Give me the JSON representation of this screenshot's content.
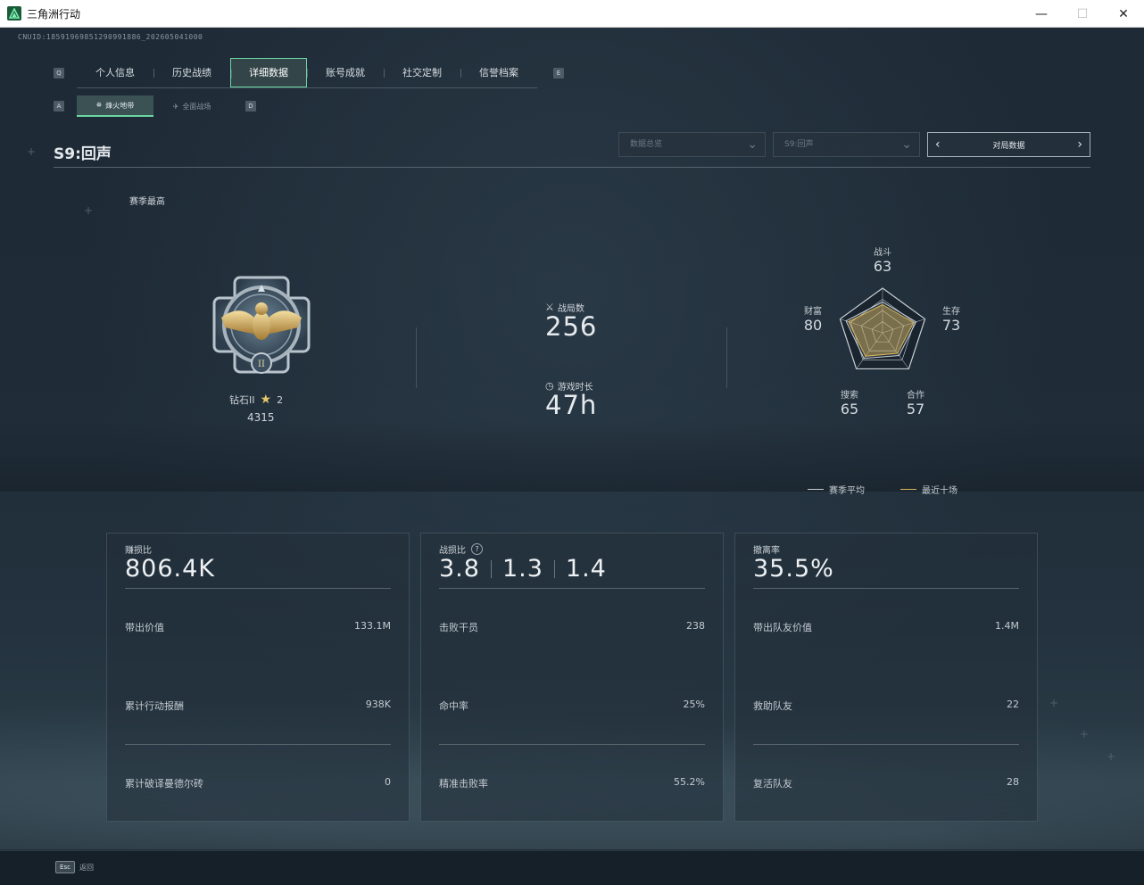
{
  "window": {
    "title": "三角洲行动",
    "minimize": "—",
    "maximize": "☐",
    "close": "✕"
  },
  "cnuid": "CNUID:18591969851290991886_202605041000",
  "tabs": {
    "left_key": "Q",
    "right_key": "E",
    "items": [
      {
        "label": "个人信息"
      },
      {
        "label": "历史战绩"
      },
      {
        "label": "详细数据"
      },
      {
        "label": "账号成就"
      },
      {
        "label": "社交定制"
      },
      {
        "label": "信誉档案"
      }
    ]
  },
  "subtabs": {
    "left_key": "A",
    "right_key": "D",
    "items": [
      {
        "label": "烽火地带"
      },
      {
        "label": "全面战场"
      }
    ]
  },
  "season": {
    "title": "S9:回声"
  },
  "filters": {
    "data_scope": "数据总览",
    "season_select": "S9:回声",
    "match_data": "对局数据"
  },
  "season_best": "赛季最高",
  "rank": {
    "name": "钻石II",
    "stars": "2",
    "score": "4315",
    "badge_numeral": "II"
  },
  "stats": {
    "matches_label": "战局数",
    "matches_value": "256",
    "playtime_label": "游戏时长",
    "playtime_value": "47h"
  },
  "radar": {
    "combat": {
      "label": "战斗",
      "value": "63"
    },
    "survival": {
      "label": "生存",
      "value": "73"
    },
    "cooperation": {
      "label": "合作",
      "value": "57"
    },
    "search": {
      "label": "搜索",
      "value": "65"
    },
    "wealth": {
      "label": "财富",
      "value": "80"
    },
    "legend_season": "赛季平均",
    "legend_recent": "最近十场",
    "color_season": "#c8cfd4",
    "color_recent": "#d9b65a"
  },
  "panels": {
    "profit": {
      "title": "赚损比",
      "value": "806.4K",
      "rows": [
        {
          "label": "带出价值",
          "value": "133.1M"
        },
        {
          "label": "累计行动报酬",
          "value": "938K"
        },
        {
          "label": "累计破译曼德尔砖",
          "value": "0"
        }
      ]
    },
    "combat": {
      "title": "战损比",
      "help": "?",
      "values": [
        "3.8",
        "1.3",
        "1.4"
      ],
      "rows": [
        {
          "label": "击败干员",
          "value": "238"
        },
        {
          "label": "命中率",
          "value": "25%"
        },
        {
          "label": "精准击败率",
          "value": "55.2%"
        }
      ]
    },
    "extract": {
      "title": "撤离率",
      "value": "35.5%",
      "rows": [
        {
          "label": "带出队友价值",
          "value": "1.4M"
        },
        {
          "label": "救助队友",
          "value": "22"
        },
        {
          "label": "复活队友",
          "value": "28"
        }
      ]
    }
  },
  "footer": {
    "esc_key": "Esc",
    "back_label": "返回"
  },
  "accent": "#6ad6a0"
}
